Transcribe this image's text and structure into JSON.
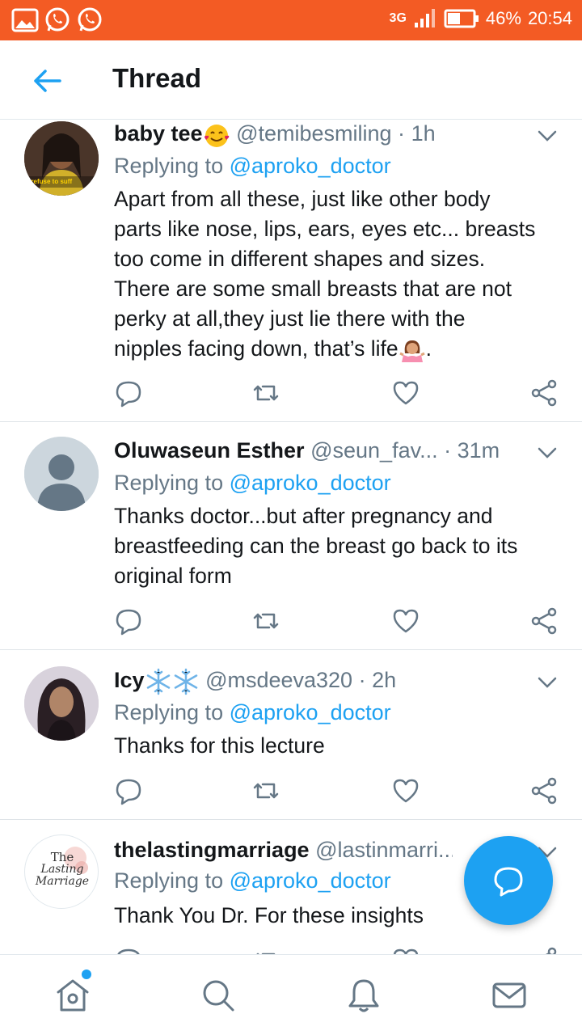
{
  "status_bar": {
    "network": "3G",
    "battery": "46%",
    "time": "20:54",
    "color": "#f35b24"
  },
  "header": {
    "title": "Thread"
  },
  "tweets": [
    {
      "name": "baby tee",
      "name_emoji": "smiling-face-with-hearts",
      "handle": "@temibesmiling",
      "time": "1h",
      "replying_prefix": "Replying to",
      "replying_to": "@aproko_doctor",
      "text_lines": [
        "Apart from all these, just like other body",
        "parts like nose, lips, ears, eyes etc... breasts",
        "too come in different shapes and sizes.",
        "There are some small breasts that are not",
        "perky at all,they just lie there with the",
        "nipples facing down, that’s life"
      ],
      "text_end": ".",
      "avatar_caption": "I refuse to suff"
    },
    {
      "name": "Oluwaseun Esther",
      "handle": "@seun_fav...",
      "time": "31m",
      "replying_prefix": "Replying to",
      "replying_to": "@aproko_doctor",
      "text_lines": [
        "Thanks doctor...but after pregnancy and",
        "breastfeeding can the breast go back to its",
        "original form"
      ]
    },
    {
      "name": "Icy",
      "name_emoji": "snowflake-snowflake",
      "handle": "@msdeeva320",
      "time": "2h",
      "replying_prefix": "Replying to",
      "replying_to": "@aproko_doctor",
      "text_lines": [
        "Thanks for this lecture"
      ]
    },
    {
      "name": "thelastingmarriage",
      "handle": "@lastinmarri...",
      "replying_prefix": "Replying to",
      "replying_to": "@aproko_doctor",
      "text_lines": [
        "Thank You Dr. For these insights"
      ],
      "avatar_logo": {
        "line1": "The",
        "line2": "Lasting",
        "line3": "Marriage"
      }
    }
  ],
  "dot_separator": "·",
  "icons": {
    "back": "arrow-left-icon",
    "reply": "reply-icon",
    "retweet": "retweet-icon",
    "like": "heart-icon",
    "share": "share-icon",
    "compose": "compose-reply-icon",
    "home": "home-icon",
    "search": "search-icon",
    "notifications": "bell-icon",
    "messages": "mail-icon"
  },
  "colors": {
    "accent": "#1da1f2",
    "secondary_text": "#657786",
    "icon": "#657786"
  }
}
